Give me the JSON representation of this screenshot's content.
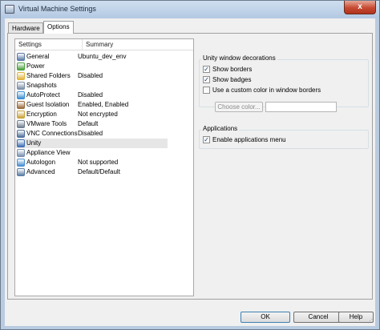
{
  "window": {
    "title": "Virtual Machine Settings",
    "close_label": "x"
  },
  "tabs": [
    {
      "label": "Hardware",
      "active": false
    },
    {
      "label": "Options",
      "active": true
    }
  ],
  "settings_list": {
    "headers": [
      "Settings",
      "Summary"
    ],
    "rows": [
      {
        "name": "General",
        "summary": "Ubuntu_dev_env",
        "icon": "general-icon",
        "color": "#5a79a8"
      },
      {
        "name": "Power",
        "summary": "",
        "icon": "power-icon",
        "color": "#4aa03e"
      },
      {
        "name": "Shared Folders",
        "summary": "Disabled",
        "icon": "shared-folders-icon",
        "color": "#e2b33a"
      },
      {
        "name": "Snapshots",
        "summary": "",
        "icon": "snapshots-icon",
        "color": "#7c8ea6"
      },
      {
        "name": "AutoProtect",
        "summary": "Disabled",
        "icon": "autoprotect-icon",
        "color": "#3b8ed1"
      },
      {
        "name": "Guest Isolation",
        "summary": "Enabled, Enabled",
        "icon": "guest-isolation-icon",
        "color": "#9a6b3c"
      },
      {
        "name": "Encryption",
        "summary": "Not encrypted",
        "icon": "encryption-icon",
        "color": "#c9a33a"
      },
      {
        "name": "VMware Tools",
        "summary": "Default",
        "icon": "vmware-tools-icon",
        "color": "#6f7f90"
      },
      {
        "name": "VNC Connections",
        "summary": "Disabled",
        "icon": "vnc-connections-icon",
        "color": "#4f6f9c"
      },
      {
        "name": "Unity",
        "summary": "",
        "icon": "unity-icon",
        "color": "#3f6fb5",
        "selected": true
      },
      {
        "name": "Appliance View",
        "summary": "",
        "icon": "appliance-view-icon",
        "color": "#7a8fb0"
      },
      {
        "name": "Autologon",
        "summary": "Not supported",
        "icon": "autologon-icon",
        "color": "#4a8fcf"
      },
      {
        "name": "Advanced",
        "summary": "Default/Default",
        "icon": "advanced-icon",
        "color": "#5c7ea5"
      }
    ]
  },
  "unity_group": {
    "title": "Unity window decorations",
    "show_borders": {
      "label": "Show borders",
      "checked": true
    },
    "show_badges": {
      "label": "Show badges",
      "checked": true
    },
    "custom_color": {
      "label": "Use a custom color in window borders",
      "checked": false
    },
    "choose_color_label": "Choose color..."
  },
  "applications_group": {
    "title": "Applications",
    "enable_menu": {
      "label": "Enable applications menu",
      "checked": true
    }
  },
  "buttons": {
    "ok": "OK",
    "cancel": "Cancel",
    "help": "Help"
  }
}
